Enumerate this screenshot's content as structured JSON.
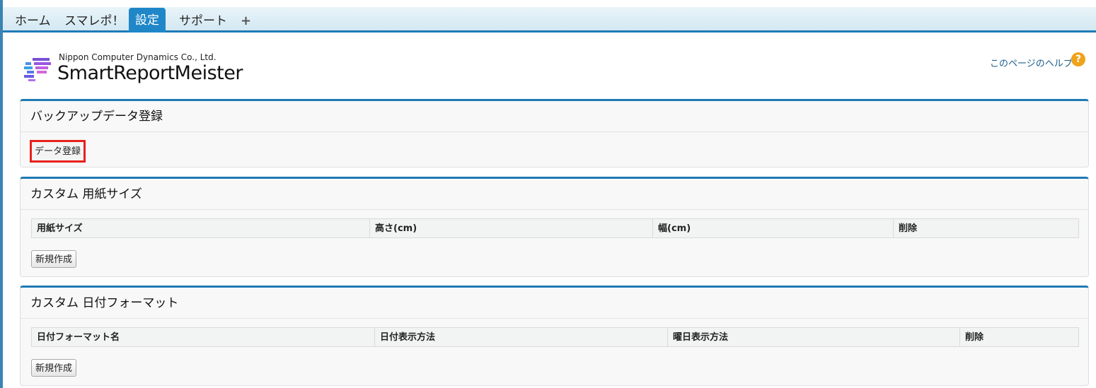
{
  "tabs": [
    {
      "label": "ホーム"
    },
    {
      "label": "スマレポ！"
    },
    {
      "label": "設定"
    },
    {
      "label": "サポート"
    }
  ],
  "tab_add": "+",
  "header": {
    "company": "Nippon Computer Dynamics Co., Ltd.",
    "product": "SmartReportMeister",
    "help_link": "このページのヘルプ",
    "help_icon": "?"
  },
  "backup": {
    "title": "バックアップデータ登録",
    "button": "データ登録"
  },
  "paper": {
    "title": "カスタム 用紙サイズ",
    "columns": [
      "用紙サイズ",
      "高さ(cm)",
      "幅(cm)",
      "削除"
    ],
    "button": "新規作成"
  },
  "date": {
    "title": "カスタム 日付フォーマット",
    "columns": [
      "日付フォーマット名",
      "日付表示方法",
      "曜日表示方法",
      "削除"
    ],
    "button": "新規作成"
  },
  "colors": {
    "accent": "#1f7ab5",
    "active_tab": "#1f87c8",
    "highlight_border": "#e8201c",
    "help_icon": "#f0a21b"
  }
}
